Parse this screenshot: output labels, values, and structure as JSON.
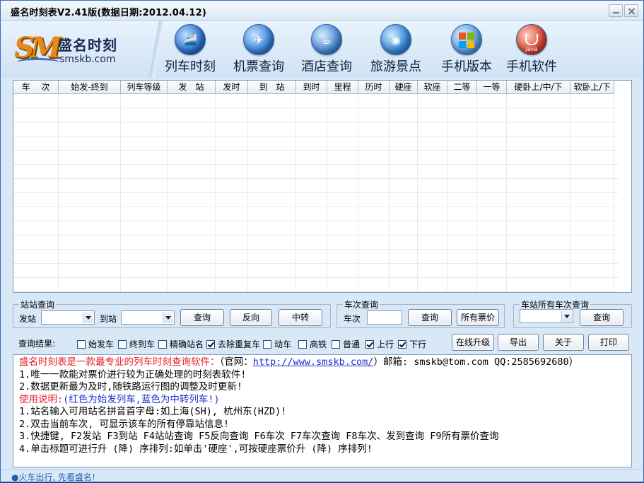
{
  "window": {
    "title": "盛名时刻表V2.41版(数据日期:2012.04.12)"
  },
  "logo": {
    "mark": "SM",
    "name_cn": "盛名时刻",
    "domain": "smskb.com"
  },
  "nav": [
    {
      "label": "列车时刻",
      "icon": "train-icon"
    },
    {
      "label": "机票查询",
      "icon": "airplane-icon"
    },
    {
      "label": "酒店查询",
      "icon": "hotel-icon"
    },
    {
      "label": "旅游景点",
      "icon": "globe-icon"
    },
    {
      "label": "手机版本",
      "icon": "windows-icon"
    },
    {
      "label": "手机软件",
      "icon": "java-icon"
    }
  ],
  "table": {
    "columns": [
      "车　 次",
      "始发-终到",
      "列车等级",
      "发　站",
      "发时",
      "到　站",
      "到时",
      "里程",
      "历时",
      "硬座",
      "软座",
      "二等",
      "一等",
      "硬卧上/中/下",
      "软卧上/下"
    ],
    "rows": []
  },
  "station_query": {
    "legend": "站站查询",
    "from_label": "发站",
    "to_label": "到站",
    "from_value": "",
    "to_value": "",
    "query_btn": "查询",
    "reverse_btn": "反向",
    "transfer_btn": "中转"
  },
  "train_query": {
    "legend": "车次查询",
    "train_label": "车次",
    "train_value": "",
    "query_btn": "查询",
    "all_prices_btn": "所有票价"
  },
  "station_all_query": {
    "legend": "车站所有车次查询",
    "station_value": "",
    "query_btn": "查询"
  },
  "filters": {
    "label": "查询结果:",
    "options": [
      {
        "label": "始发车",
        "checked": false
      },
      {
        "label": "终到车",
        "checked": false
      },
      {
        "label": "精确站名",
        "checked": false
      },
      {
        "label": "去除重复车",
        "checked": true
      },
      {
        "label": "动车",
        "checked": false
      },
      {
        "label": "高铁",
        "checked": false
      },
      {
        "label": "普通",
        "checked": false
      },
      {
        "label": "上行",
        "checked": true
      },
      {
        "label": "下行",
        "checked": true
      }
    ]
  },
  "actions": {
    "upgrade": "在线升级",
    "export": "导出",
    "about": "关于",
    "print": "打印"
  },
  "info": {
    "intro_red": "盛名时刻表是一款最专业的列车时刻查询软件：",
    "site_prefix": "（官网：",
    "site_url": "http://www.smskb.com/",
    "contact": "）邮箱: smskb@tom.com QQ:2585692680）",
    "line1": "1.唯一一款能对票价进行较为正确处理的时刻表软件!",
    "line2": "2.数据更新最为及时,随铁路运行图的调整及时更新!",
    "usage_red": "使用说明:",
    "usage_blue": "(红色为始发列车,蓝色为中转列车!)",
    "tip1": "1.站名输入可用站名拼音首字母:如上海(SH), 杭州东(HZD)!",
    "tip2": "2.双击当前车次, 可显示该车的所有停靠站信息!",
    "tip3": "3.快捷键, F2发站 F3到站 F4站站查询 F5反向查询 F6车次 F7车次查询 F8车次、发到查询 F9所有票价查询",
    "tip4": "4.单击标题可进行升 (降) 序排列:如单击'硬座',可按硬座票价升 (降) 序排列!"
  },
  "status": {
    "text": "●火车出行, 先看盛名!"
  },
  "colors": {
    "accent_red": "#e8202a",
    "accent_blue": "#1a2fd0",
    "window_bg": "#d9e8f6"
  }
}
